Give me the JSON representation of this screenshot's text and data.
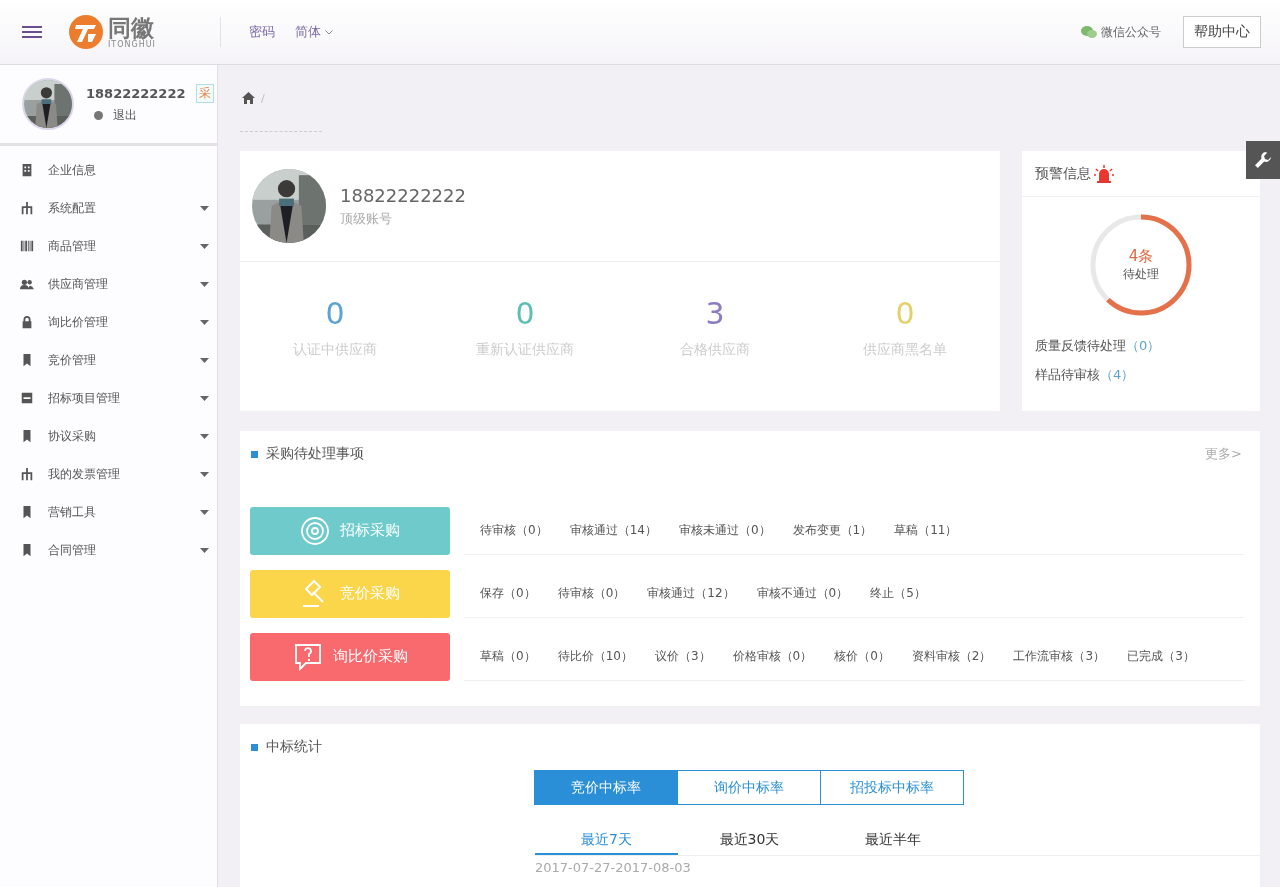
{
  "header": {
    "logo": {
      "name": "同徽",
      "sub": "ITONGHUI"
    },
    "links": [
      {
        "label": "密码",
        "dropdown": false
      },
      {
        "label": "简体",
        "dropdown": true
      }
    ],
    "wechat": "微信公众号",
    "help_button": "帮助中心"
  },
  "sidebar": {
    "user": {
      "name": "18822222222",
      "badge": "采",
      "logout": "退出"
    },
    "items": [
      {
        "label": "企业信息",
        "kind": "building",
        "has_submenu": false
      },
      {
        "label": "系统配置",
        "kind": "sitemap",
        "has_submenu": true
      },
      {
        "label": "商品管理",
        "kind": "barcode",
        "has_submenu": true
      },
      {
        "label": "供应商管理",
        "kind": "users",
        "has_submenu": true
      },
      {
        "label": "询比价管理",
        "kind": "lock",
        "has_submenu": true
      },
      {
        "label": "竞价管理",
        "kind": "bookmark",
        "has_submenu": true
      },
      {
        "label": "招标项目管理",
        "kind": "minus",
        "has_submenu": true
      },
      {
        "label": "协议采购",
        "kind": "bookmark",
        "has_submenu": true
      },
      {
        "label": "我的发票管理",
        "kind": "sitemap",
        "has_submenu": true
      },
      {
        "label": "营销工具",
        "kind": "bookmark",
        "has_submenu": true
      },
      {
        "label": "合同管理",
        "kind": "bookmark",
        "has_submenu": true
      }
    ]
  },
  "breadcrumb": {
    "separator": "/"
  },
  "profile": {
    "name": "18822222222",
    "role": "顶级账号"
  },
  "stats": [
    {
      "value": "0",
      "label": "认证中供应商",
      "color": "#5ba4cf"
    },
    {
      "value": "0",
      "label": "重新认证供应商",
      "color": "#5bbfb5"
    },
    {
      "value": "3",
      "label": "合格供应商",
      "color": "#8e7cc3"
    },
    {
      "value": "0",
      "label": "供应商黑名单",
      "color": "#e2d06a"
    }
  ],
  "warning": {
    "title": "预警信息",
    "count": "4条",
    "count_label": "待处理",
    "level": 0.62,
    "lines": [
      {
        "label": "质量反馈待处理",
        "count": "（0）"
      },
      {
        "label": "样品待审核",
        "count": "（4）"
      }
    ]
  },
  "todo": {
    "title": "采购待处理事项",
    "more": "更多>",
    "rows": [
      {
        "kind": "target",
        "label": "招标采购",
        "color": "#6ecacb",
        "items": [
          "待审核（0）",
          "审核通过（14）",
          "审核未通过（0）",
          "发布变更（1）",
          "草稿（11）"
        ]
      },
      {
        "kind": "gavel",
        "label": "竞价采购",
        "color": "#fbd54a",
        "items": [
          "保存（0）",
          "待审核（0）",
          "审核通过（12）",
          "审核不通过（0）",
          "终止（5）"
        ]
      },
      {
        "kind": "question",
        "label": "询比价采购",
        "color": "#f86a6e",
        "items": [
          "草稿（0）",
          "待比价（10）",
          "议价（3）",
          "价格审核（0）",
          "核价（0）",
          "资料审核（2）",
          "工作流审核（3）",
          "已完成（3）"
        ]
      }
    ]
  },
  "win_stats": {
    "title": "中标统计",
    "tabs": [
      {
        "label": "竞价中标率",
        "selected": true
      },
      {
        "label": "询价中标率",
        "selected": false
      },
      {
        "label": "招投标中标率",
        "selected": false
      }
    ],
    "periods": [
      {
        "label": "最近7天",
        "selected": true
      },
      {
        "label": "最近30天",
        "selected": false
      },
      {
        "label": "最近半年",
        "selected": false
      }
    ],
    "date_range": "2017-07-27-2017-08-03"
  }
}
